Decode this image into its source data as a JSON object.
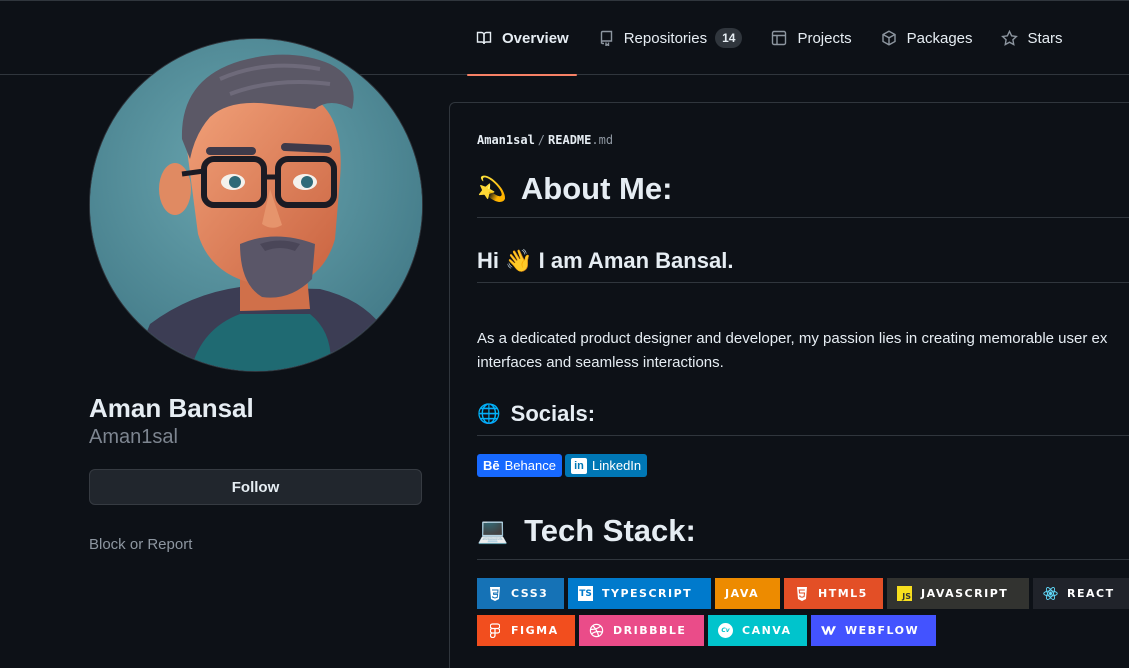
{
  "tabs": [
    {
      "label": "Overview",
      "icon": "book-icon",
      "active": true
    },
    {
      "label": "Repositories",
      "icon": "repo-icon",
      "count": "14"
    },
    {
      "label": "Projects",
      "icon": "table-icon"
    },
    {
      "label": "Packages",
      "icon": "package-icon"
    },
    {
      "label": "Stars",
      "icon": "star-icon"
    }
  ],
  "profile": {
    "name": "Aman Bansal",
    "login": "Aman1sal",
    "follow_label": "Follow",
    "block_label": "Block or Report"
  },
  "readme": {
    "path_owner": "Aman1sal",
    "path_sep": "/",
    "path_file": "README",
    "path_ext": ".md",
    "about_title": "About Me:",
    "about_emoji": "💫",
    "hi_title": "Hi 👋 I am Aman Bansal.",
    "para_line1": "As a dedicated product designer and developer, my passion lies in creating memorable user ex",
    "para_line2": "interfaces and seamless interactions.",
    "socials_title": "Socials:",
    "socials_emoji": "🌐",
    "socials": [
      {
        "label": "Behance",
        "icon": "behance-icon",
        "color": "#1769ff"
      },
      {
        "label": "LinkedIn",
        "icon": "linkedin-icon",
        "color": "#0077b5"
      }
    ],
    "tech_title": "Tech Stack:",
    "tech_emoji": "💻",
    "tech": [
      {
        "label": "CSS3",
        "color": "#1572b6"
      },
      {
        "label": "TYPESCRIPT",
        "color": "#007acc"
      },
      {
        "label": "JAVA",
        "color": "#ed8b00"
      },
      {
        "label": "HTML5",
        "color": "#e34f26"
      },
      {
        "label": "JAVASCRIPT",
        "color": "#323330"
      },
      {
        "label": "REACT",
        "color": "#20232a"
      },
      {
        "label": "FIGMA",
        "color": "#f24e1e"
      },
      {
        "label": "DRIBBBLE",
        "color": "#ea4c89"
      },
      {
        "label": "CANVA",
        "color": "#00c4cc"
      },
      {
        "label": "WEBFLOW",
        "color": "#4353ff"
      }
    ]
  }
}
